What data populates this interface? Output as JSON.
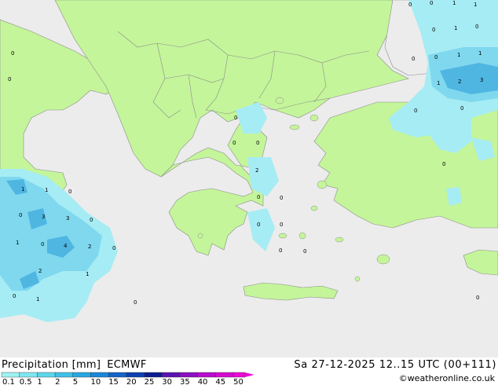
{
  "header": {
    "title": "Precipitation [mm]",
    "model": "ECMWF",
    "valid_time": "Sa 27-12-2025 12..15 UTC (00+111)",
    "credit": "©weatheronline.co.uk"
  },
  "legend": {
    "labels": [
      "0.1",
      "0.5",
      "1",
      "2",
      "5",
      "10",
      "15",
      "20",
      "25",
      "30",
      "35",
      "40",
      "45",
      "50"
    ],
    "colors": [
      "#9ef2f2",
      "#7ee6f0",
      "#5ed6ec",
      "#3ec0e6",
      "#28a6e0",
      "#1a86d8",
      "#1464c8",
      "#0c40b0",
      "#0a1e90",
      "#5a14b0",
      "#8a10c0",
      "#b60ccc",
      "#d40ad0",
      "#ee08d6"
    ]
  },
  "colors": {
    "land": "#c4f59a",
    "sea": "#ececec",
    "precip_light": "#a6ecf4",
    "precip_medium": "#7fd8ee",
    "precip_heavy": "#4fb6e2",
    "border": "#8c8c8c"
  },
  "precip_labels": [
    "0",
    "0",
    "1",
    "1",
    "0",
    "0",
    "1",
    "0",
    "1",
    "1",
    "0",
    "1",
    "2",
    "3",
    "0",
    "0",
    "0",
    "0",
    "0",
    "0",
    "2",
    "0",
    "0",
    "0",
    "0",
    "0",
    "0",
    "0",
    "1",
    "1",
    "0",
    "0",
    "3",
    "3",
    "0",
    "0",
    "4",
    "2",
    "0",
    "1",
    "2",
    "0",
    "1",
    "1",
    "0",
    "0",
    "0"
  ]
}
